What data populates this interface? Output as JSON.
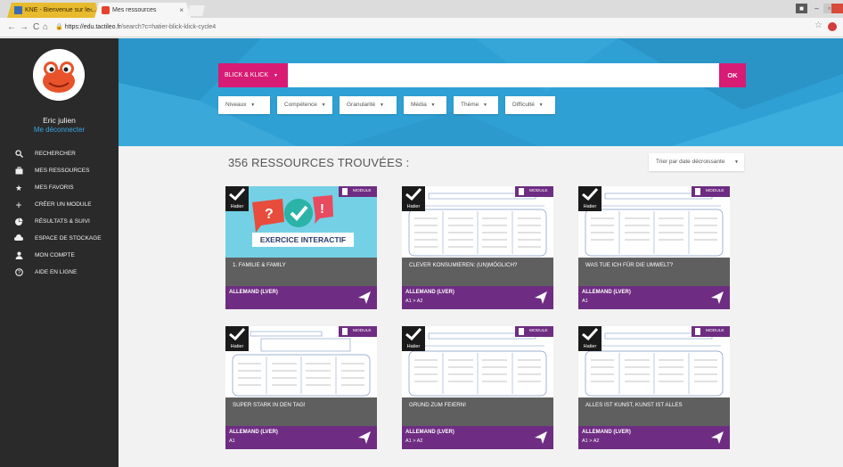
{
  "browser": {
    "tabs": [
      {
        "label": "KNE - Bienvenue sur le ...",
        "active": false
      },
      {
        "label": "Mes ressources",
        "active": true
      }
    ],
    "url_host": "https://edu.tactileo.fr",
    "url_path": "/search?c=hatier-blick-klick-cycle4"
  },
  "user": {
    "name": "Eric julien",
    "logout": "Me déconnecter"
  },
  "menu": [
    {
      "label": "RECHERCHER",
      "icon": "search-icon"
    },
    {
      "label": "MES RESSOURCES",
      "icon": "briefcase-icon"
    },
    {
      "label": "MES FAVORIS",
      "icon": "star-icon"
    },
    {
      "label": "CRÉER UN MODULE",
      "icon": "plus-icon"
    },
    {
      "label": "RÉSULTATS & SUIVI",
      "icon": "chart-icon"
    },
    {
      "label": "ESPACE DE STOCKAGE",
      "icon": "cloud-icon"
    },
    {
      "label": "MON COMPTE",
      "icon": "user-icon"
    },
    {
      "label": "AIDE EN LIGNE",
      "icon": "help-icon"
    }
  ],
  "search": {
    "selector": "BLICK & KLICK",
    "placeholder": "",
    "ok": "OK"
  },
  "filters": [
    "Niveaux",
    "Compétence",
    "Granularité",
    "Média",
    "Thème",
    "Difficulté"
  ],
  "results": {
    "count_text": "356 RESSOURCES TROUVÉES :",
    "sort": "Trier par date décroissante"
  },
  "badge_label": "MODULE",
  "publisher": "Hatier",
  "interactive_label": "EXERCICE INTERACTIF",
  "cards": [
    {
      "title": "1. FAMILIE & FAMILY",
      "subject": "ALLEMAND (LVER)",
      "level": ""
    },
    {
      "title": "CLEVER KONSUMIEREN: (UN)MÖGLICH?",
      "subject": "ALLEMAND (LVER)",
      "level": "A1 > A2"
    },
    {
      "title": "WAS TUE ICH FÜR DIE UMWELT?",
      "subject": "ALLEMAND (LVER)",
      "level": "A1"
    },
    {
      "title": "SUPER STARK IN DEN TAG!",
      "subject": "ALLEMAND (LVER)",
      "level": "A1"
    },
    {
      "title": "GRUND ZUM FEIERN!",
      "subject": "ALLEMAND (LVER)",
      "level": "A1 > A2"
    },
    {
      "title": "ALLES IST KUNST, KUNST IST ALLES",
      "subject": "ALLEMAND (LVER)",
      "level": "A1 > A2"
    }
  ],
  "colors": {
    "accent": "#d81b74",
    "hero": "#2fa0d3",
    "card_footer": "#6e2d82",
    "sidebar": "#2a2a2a"
  }
}
